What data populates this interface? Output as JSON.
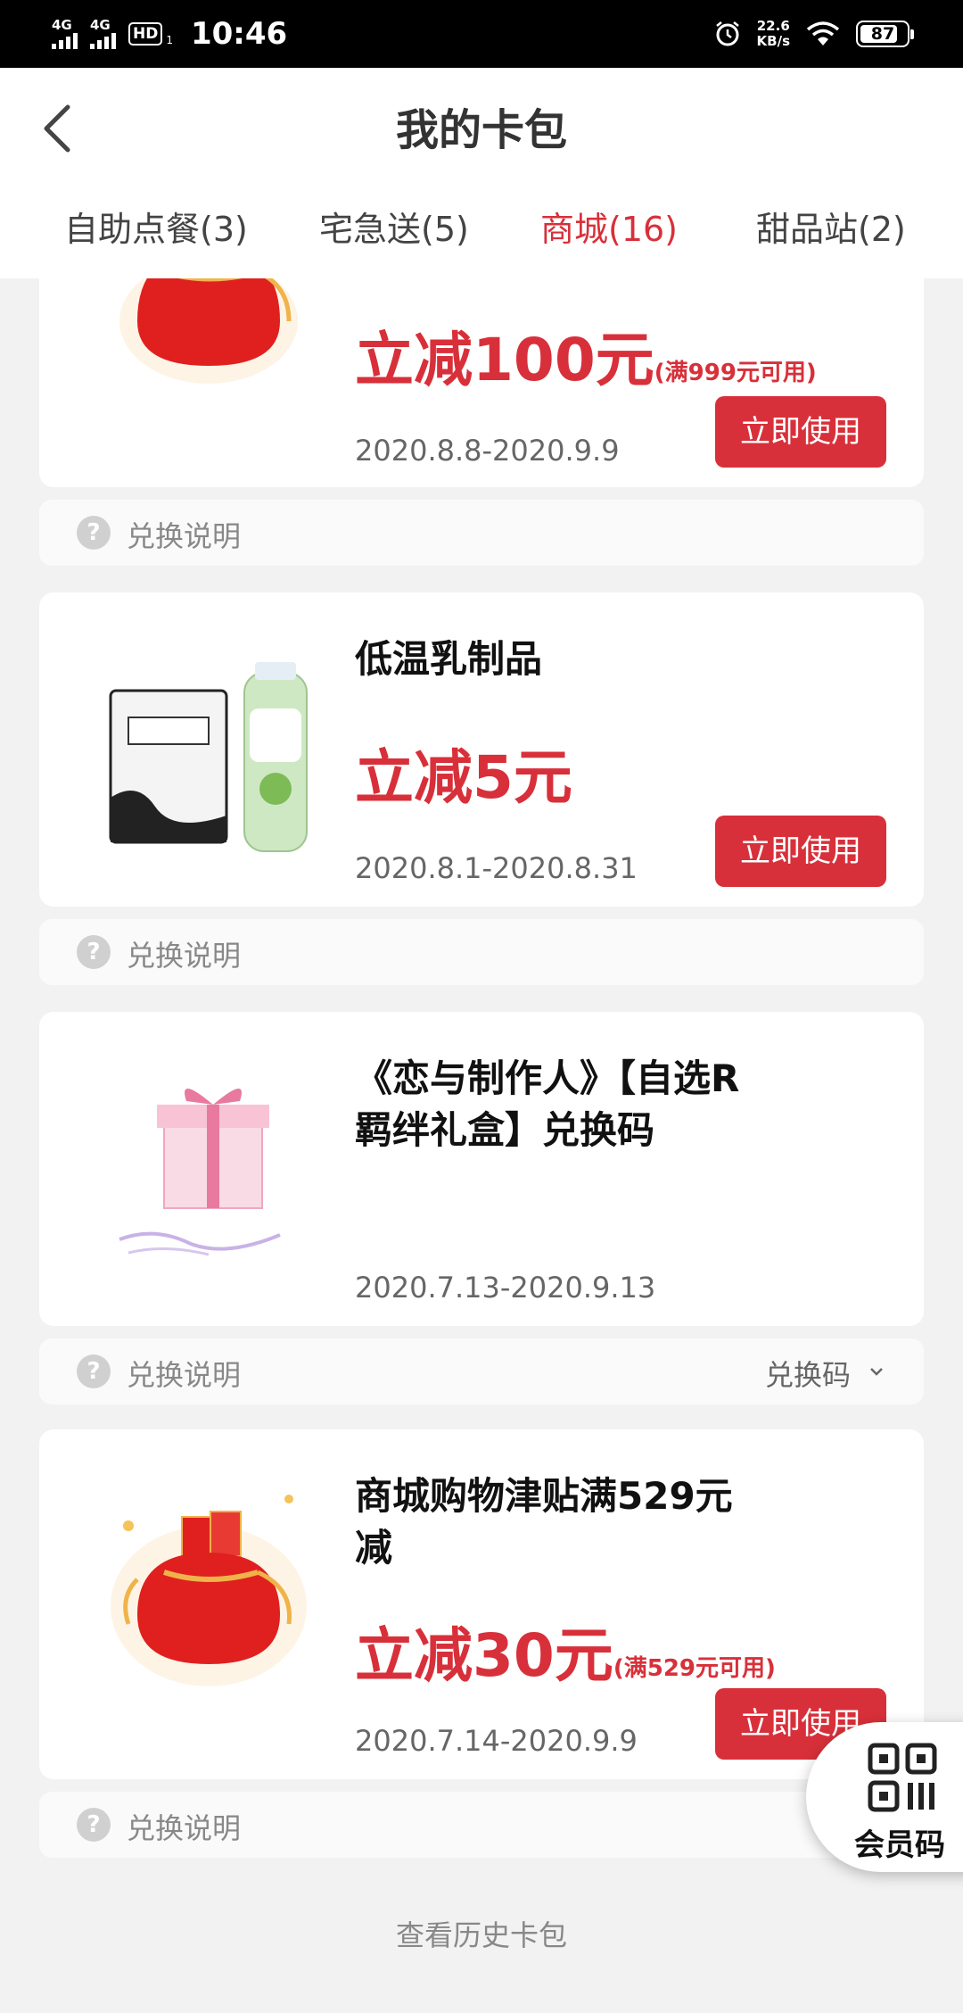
{
  "status_bar": {
    "network_1": "4G",
    "network_2": "4G",
    "hd": "HD",
    "hd_sub": "1",
    "time": "10:46",
    "speed_value": "22.6",
    "speed_unit": "KB/s",
    "battery": "87"
  },
  "header": {
    "title": "我的卡包",
    "tabs": [
      {
        "label": "自助点餐(3)",
        "active": false
      },
      {
        "label": "宅急送(5)",
        "active": false
      },
      {
        "label": "商城(16)",
        "active": true
      },
      {
        "label": "甜品站(2)",
        "active": false
      }
    ]
  },
  "coupons": [
    {
      "image": "red-lucky-bag",
      "name": "",
      "discount": "立减100元",
      "condition": "(满999元可用)",
      "date": "2020.8.8-2020.9.9",
      "action": "立即使用",
      "note": "兑换说明"
    },
    {
      "image": "milk-and-drink",
      "name": "低温乳制品",
      "discount": "立减5元",
      "condition": "",
      "date": "2020.8.1-2020.8.31",
      "action": "立即使用",
      "note": "兑换说明"
    },
    {
      "image": "pink-gift-box",
      "name": "《恋与制作人》【自选R羁绊礼盒】兑换码",
      "name_line1": "《恋与制作人》【自选R",
      "name_line2": "羁绊礼盒】兑换码",
      "discount": "",
      "condition": "",
      "date": "2020.7.13-2020.9.13",
      "action": "",
      "note": "兑换说明",
      "code_link": "兑换码"
    },
    {
      "image": "red-lucky-bag",
      "name_line1": "商城购物津贴满529元",
      "name_line2": "减",
      "discount": "立减30元",
      "condition": "(满529元可用)",
      "date": "2020.7.14-2020.9.9",
      "action": "立即使用",
      "note": "兑换说明"
    }
  ],
  "history_link": "查看历史卡包",
  "member_code": {
    "label": "会员码",
    "icon": "qr-code-icon"
  },
  "colors": {
    "accent": "#d8303a",
    "background": "#f2f2f2"
  }
}
